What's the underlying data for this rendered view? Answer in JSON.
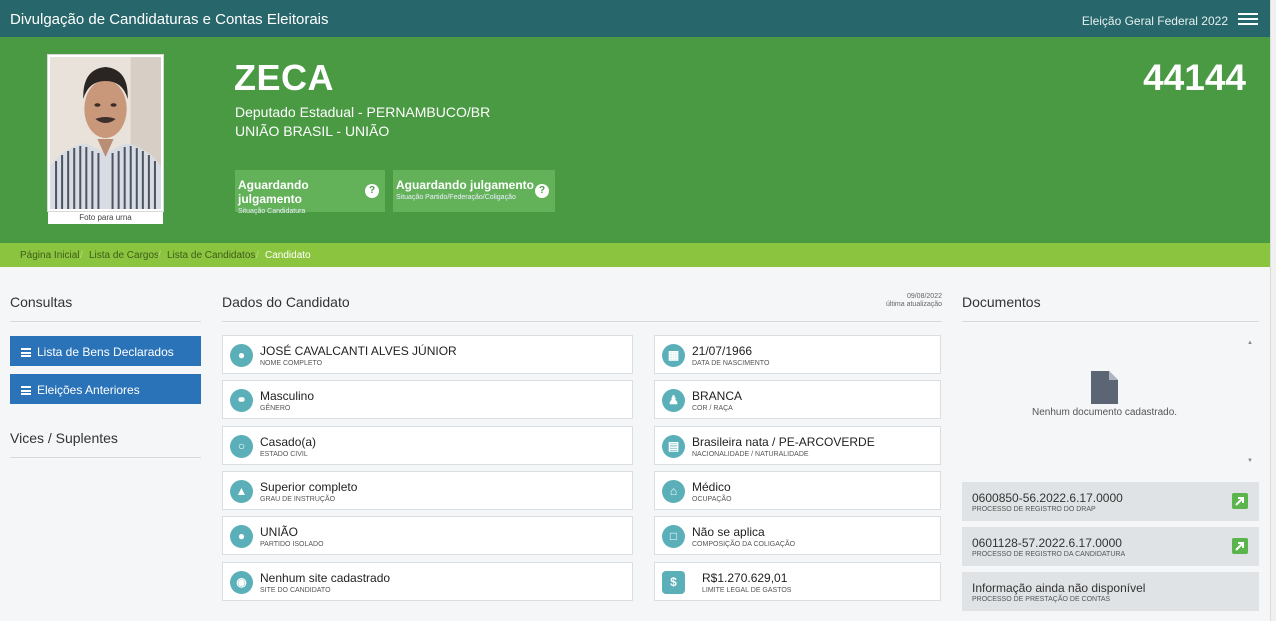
{
  "header": {
    "title": "Divulgação de Candidaturas e Contas Eleitorais",
    "election": "Eleição Geral Federal 2022"
  },
  "candidate": {
    "name": "ZECA",
    "office": "Deputado Estadual - PERNAMBUCO/BR",
    "party": "UNIÃO BRASIL - UNIÃO",
    "number": "44144",
    "photo_caption": "Foto para urna",
    "status": [
      {
        "main": "Aguardando julgamento",
        "sub": "Situação Candidatura"
      },
      {
        "main": "Aguardando julgamento",
        "sub": "Situação Partido/Federação/Coligação"
      }
    ]
  },
  "breadcrumb": {
    "items": [
      "Página Inicial",
      "Lista de Cargos",
      "Lista de Candidatos",
      "Candidato"
    ],
    "separator": "/"
  },
  "consultas": {
    "title": "Consultas",
    "buttons": [
      "Lista de Bens Declarados",
      "Eleições Anteriores"
    ],
    "vices_title": "Vices / Suplentes"
  },
  "dados": {
    "title": "Dados do Candidato",
    "updated_date": "09/08/2022",
    "updated_label": "última atualização",
    "fields": [
      {
        "value": "JOSÉ CAVALCANTI ALVES JÚNIOR",
        "label": "NOME COMPLETO",
        "icon": "user-icon"
      },
      {
        "value": "21/07/1966",
        "label": "DATA DE NASCIMENTO",
        "icon": "calendar-icon"
      },
      {
        "value": "Masculino",
        "label": "GÊNERO",
        "icon": "gender-icon"
      },
      {
        "value": "BRANCA",
        "label": "COR / RAÇA",
        "icon": "person-icon"
      },
      {
        "value": "Casado(a)",
        "label": "ESTADO CIVIL",
        "icon": "ring-icon"
      },
      {
        "value": "Brasileira nata / PE-ARCOVERDE",
        "label": "NACIONALIDADE / NATURALIDADE",
        "icon": "map-icon"
      },
      {
        "value": "Superior completo",
        "label": "GRAU DE INSTRUÇÃO",
        "icon": "graduation-cap-icon"
      },
      {
        "value": "Médico",
        "label": "OCUPAÇÃO",
        "icon": "bank-icon"
      },
      {
        "value": "UNIÃO",
        "label": "PARTIDO ISOLADO",
        "icon": "group-icon"
      },
      {
        "value": "Não se aplica",
        "label": "COMPOSIÇÃO DA COLIGAÇÃO",
        "icon": "folder-icon"
      },
      {
        "value": "Nenhum site cadastrado",
        "label": "SITE DO CANDIDATO",
        "icon": "globe-icon"
      },
      {
        "value": "R$1.270.629,01",
        "label": "LIMITE LEGAL DE GASTOS",
        "icon": "dollar-icon"
      }
    ]
  },
  "documentos": {
    "title": "Documentos",
    "empty": "Nenhum documento cadastrado.",
    "processes": [
      {
        "value": "0600850-56.2022.6.17.0000",
        "label": "PROCESSO DE REGISTRO DO DRAP",
        "link": true
      },
      {
        "value": "0601128-57.2022.6.17.0000",
        "label": "PROCESSO DE REGISTRO DA CANDIDATURA",
        "link": true
      },
      {
        "value": "Informação ainda não disponível",
        "label": "PROCESSO DE PRESTAÇÃO DE CONTAS",
        "link": false
      }
    ]
  },
  "colors": {
    "topbar": "#27666b",
    "hero": "#4a9a44",
    "breadcrumb": "#8bc53f",
    "button": "#2b73b8",
    "icon_circle": "#5aafb9"
  }
}
